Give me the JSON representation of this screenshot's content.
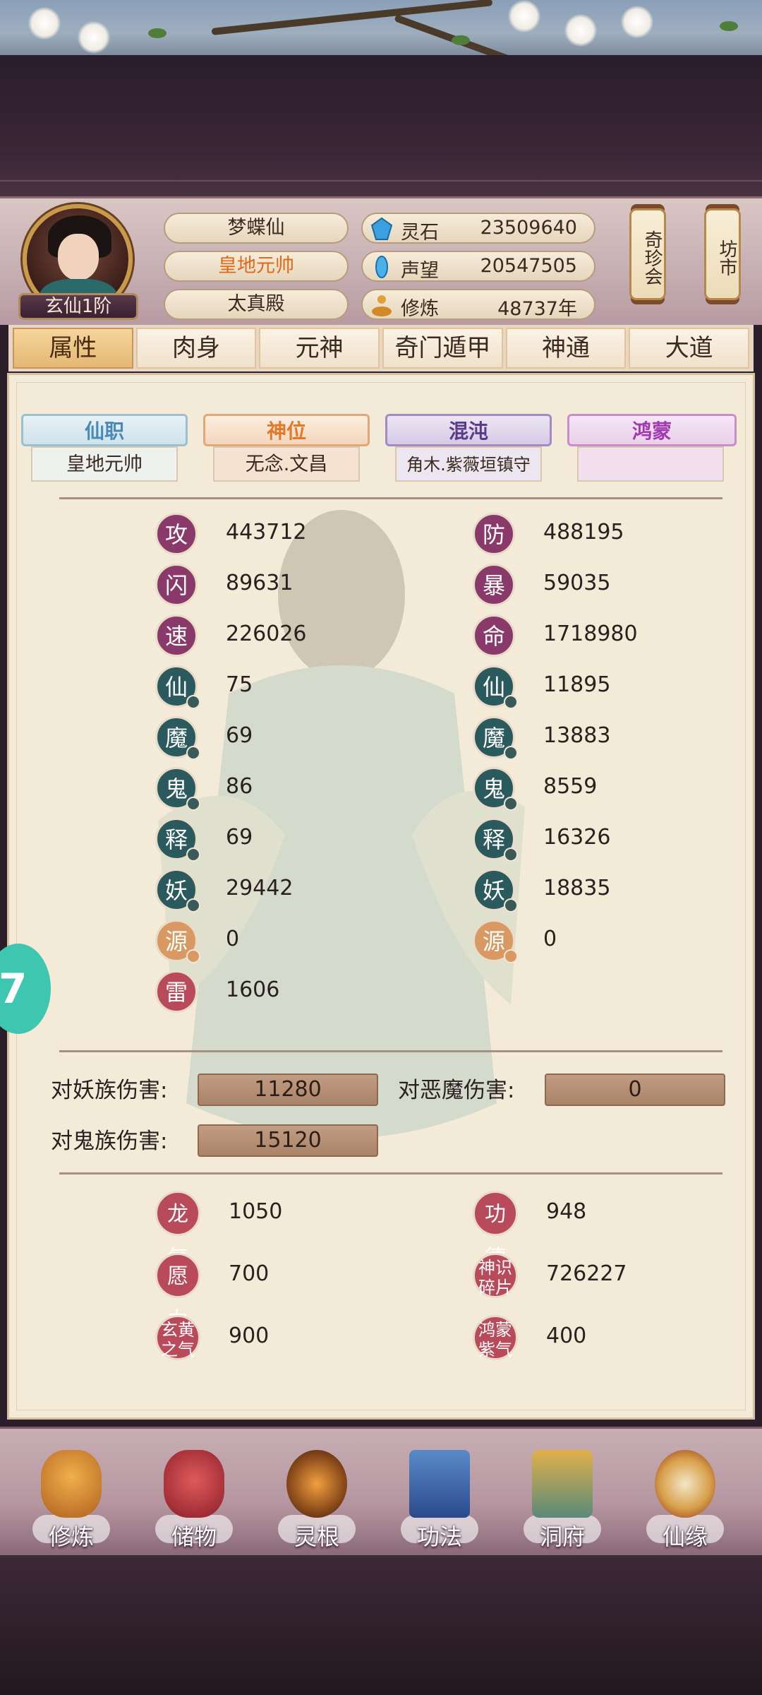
{
  "profile": {
    "rank": "玄仙1阶",
    "name": "梦蝶仙",
    "title": "皇地元帅",
    "sect": "太真殿"
  },
  "resources": [
    {
      "label": "灵石",
      "value": "23509640",
      "icon": "crystal-icon"
    },
    {
      "label": "声望",
      "value": "20547505",
      "icon": "feather-icon"
    },
    {
      "label": "修炼",
      "value": "48737年",
      "icon": "meditation-icon"
    }
  ],
  "side_buttons": {
    "treasure": "奇珍会",
    "market": "坊市"
  },
  "tabs": [
    "属性",
    "肉身",
    "元神",
    "奇门遁甲",
    "神通",
    "大道"
  ],
  "roles": [
    {
      "label": "仙职",
      "value": "皇地元帅",
      "color": "#4a8ab8"
    },
    {
      "label": "神位",
      "value": "无念.文昌",
      "color": "#e07a2a"
    },
    {
      "label": "混沌",
      "value": "角木.紫薇垣镇守",
      "color": "#5a3a8a"
    },
    {
      "label": "鸿蒙",
      "value": "",
      "color": "#a03ab0"
    }
  ],
  "stats_left": [
    {
      "badge": "攻",
      "value": "443712"
    },
    {
      "badge": "闪",
      "value": "89631"
    },
    {
      "badge": "速",
      "value": "226026"
    },
    {
      "badge": "仙",
      "value": "75"
    },
    {
      "badge": "魔",
      "value": "69"
    },
    {
      "badge": "鬼",
      "value": "86"
    },
    {
      "badge": "释",
      "value": "69"
    },
    {
      "badge": "妖",
      "value": "29442"
    },
    {
      "badge": "源",
      "value": "0"
    },
    {
      "badge": "雷",
      "value": "1606"
    }
  ],
  "stats_right": [
    {
      "badge": "防",
      "value": "488195"
    },
    {
      "badge": "暴",
      "value": "59035"
    },
    {
      "badge": "命",
      "value": "1718980"
    },
    {
      "badge": "仙",
      "value": "11895"
    },
    {
      "badge": "魔",
      "value": "13883"
    },
    {
      "badge": "鬼",
      "value": "8559"
    },
    {
      "badge": "释",
      "value": "16326"
    },
    {
      "badge": "妖",
      "value": "18835"
    },
    {
      "badge": "源",
      "value": "0"
    }
  ],
  "damage": {
    "yao_label": "对妖族伤害:",
    "yao_value": "11280",
    "demon_label": "对恶魔伤害:",
    "demon_value": "0",
    "ghost_label": "对鬼族伤害:",
    "ghost_value": "15120"
  },
  "extras": [
    {
      "badge": "龙气",
      "value": "1050"
    },
    {
      "badge": "功德",
      "value": "948"
    },
    {
      "badge": "愿力",
      "value": "700"
    },
    {
      "badge": "神识碎片",
      "value": "726227"
    },
    {
      "badge": "玄黄之气",
      "value": "900"
    },
    {
      "badge": "鸿蒙紫气",
      "value": "400"
    }
  ],
  "bottom_nav": [
    "修炼",
    "储物",
    "灵根",
    "功法",
    "洞府",
    "仙缘"
  ],
  "float_button": "7"
}
